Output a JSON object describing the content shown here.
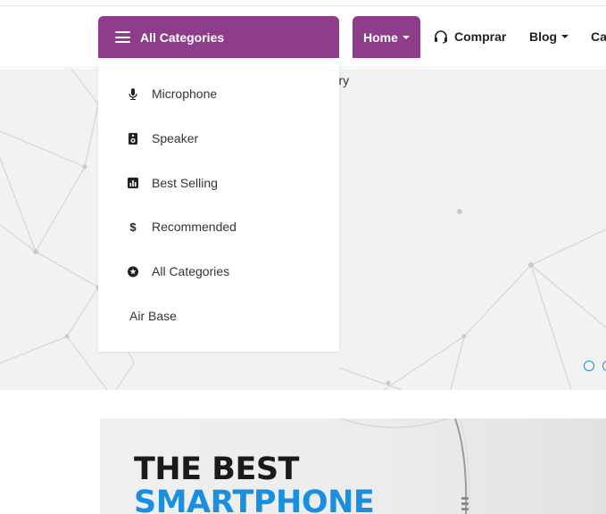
{
  "header": {
    "categories_button": "All Categories",
    "nav": {
      "home": "Home",
      "comprar": "Comprar",
      "blog": "Blog",
      "cut": "Ca"
    }
  },
  "dropdown": {
    "items": [
      {
        "label": "Microphone",
        "icon": "microphone-icon"
      },
      {
        "label": "Speaker",
        "icon": "speaker-icon"
      },
      {
        "label": "Best Selling",
        "icon": "chart-icon"
      },
      {
        "label": "Recommended",
        "icon": "dollar-icon"
      },
      {
        "label": "All Categories",
        "icon": "star-circle-icon"
      },
      {
        "label": "Air Base"
      }
    ]
  },
  "hero": {
    "partial_text": "erry"
  },
  "banner": {
    "line1": "THE BEST",
    "line2": "SMARTPHONE"
  },
  "colors": {
    "accent": "#8f3d8b",
    "highlight": "#1a8fe0",
    "dot": "#1a8cd8"
  }
}
